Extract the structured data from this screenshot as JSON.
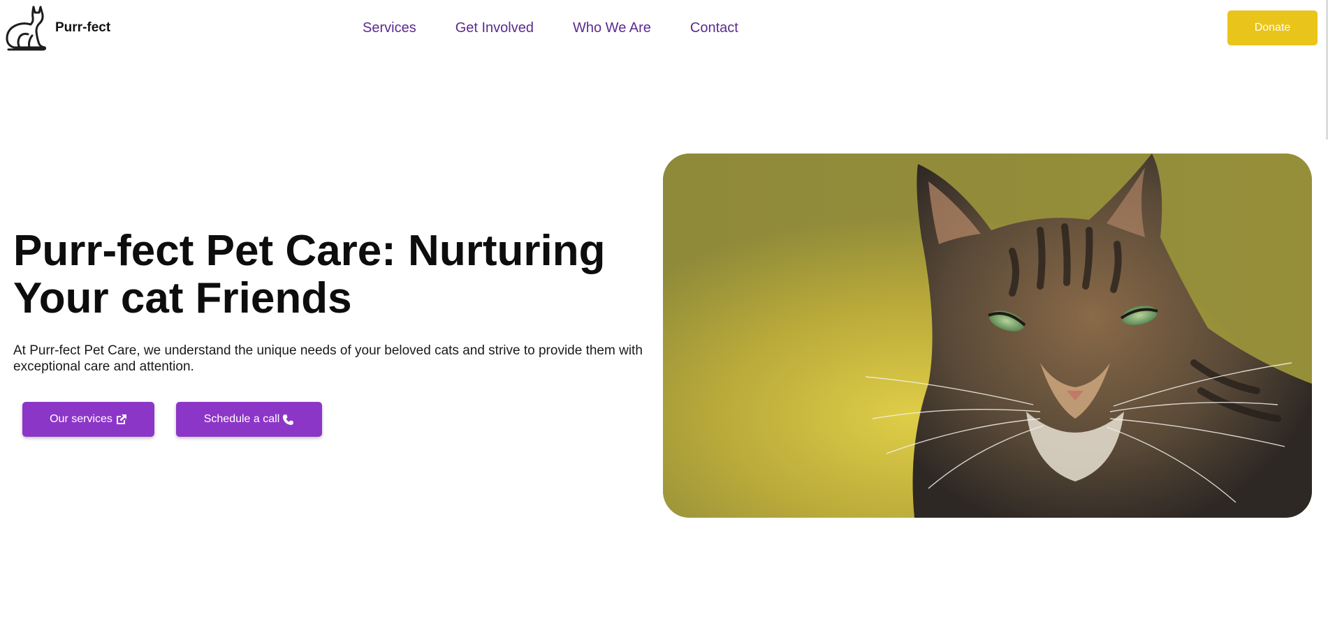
{
  "header": {
    "brand": "Purr-fect",
    "logo_icon": "cat-outline-icon",
    "nav": [
      {
        "label": "Services"
      },
      {
        "label": "Get Involved"
      },
      {
        "label": "Who We Are"
      },
      {
        "label": "Contact"
      }
    ],
    "donate_label": "Donate"
  },
  "hero": {
    "title_line1": "Purr-fect Pet Care: Nurturing",
    "title_line2": "Your cat Friends",
    "description": "At Purr-fect Pet Care, we understand the unique needs of your beloved cats and strive to provide them with exceptional care and attention.",
    "buttons": {
      "services_label": "Our services",
      "services_icon": "external-link-icon",
      "call_label": "Schedule a call",
      "call_icon": "phone-icon"
    },
    "image_subject": "tabby-cat-photo"
  },
  "colors": {
    "nav_text": "#5b2a8f",
    "donate_bg": "#e9c41a",
    "button_bg": "#8c36c8",
    "heading": "#0d0d0d"
  }
}
